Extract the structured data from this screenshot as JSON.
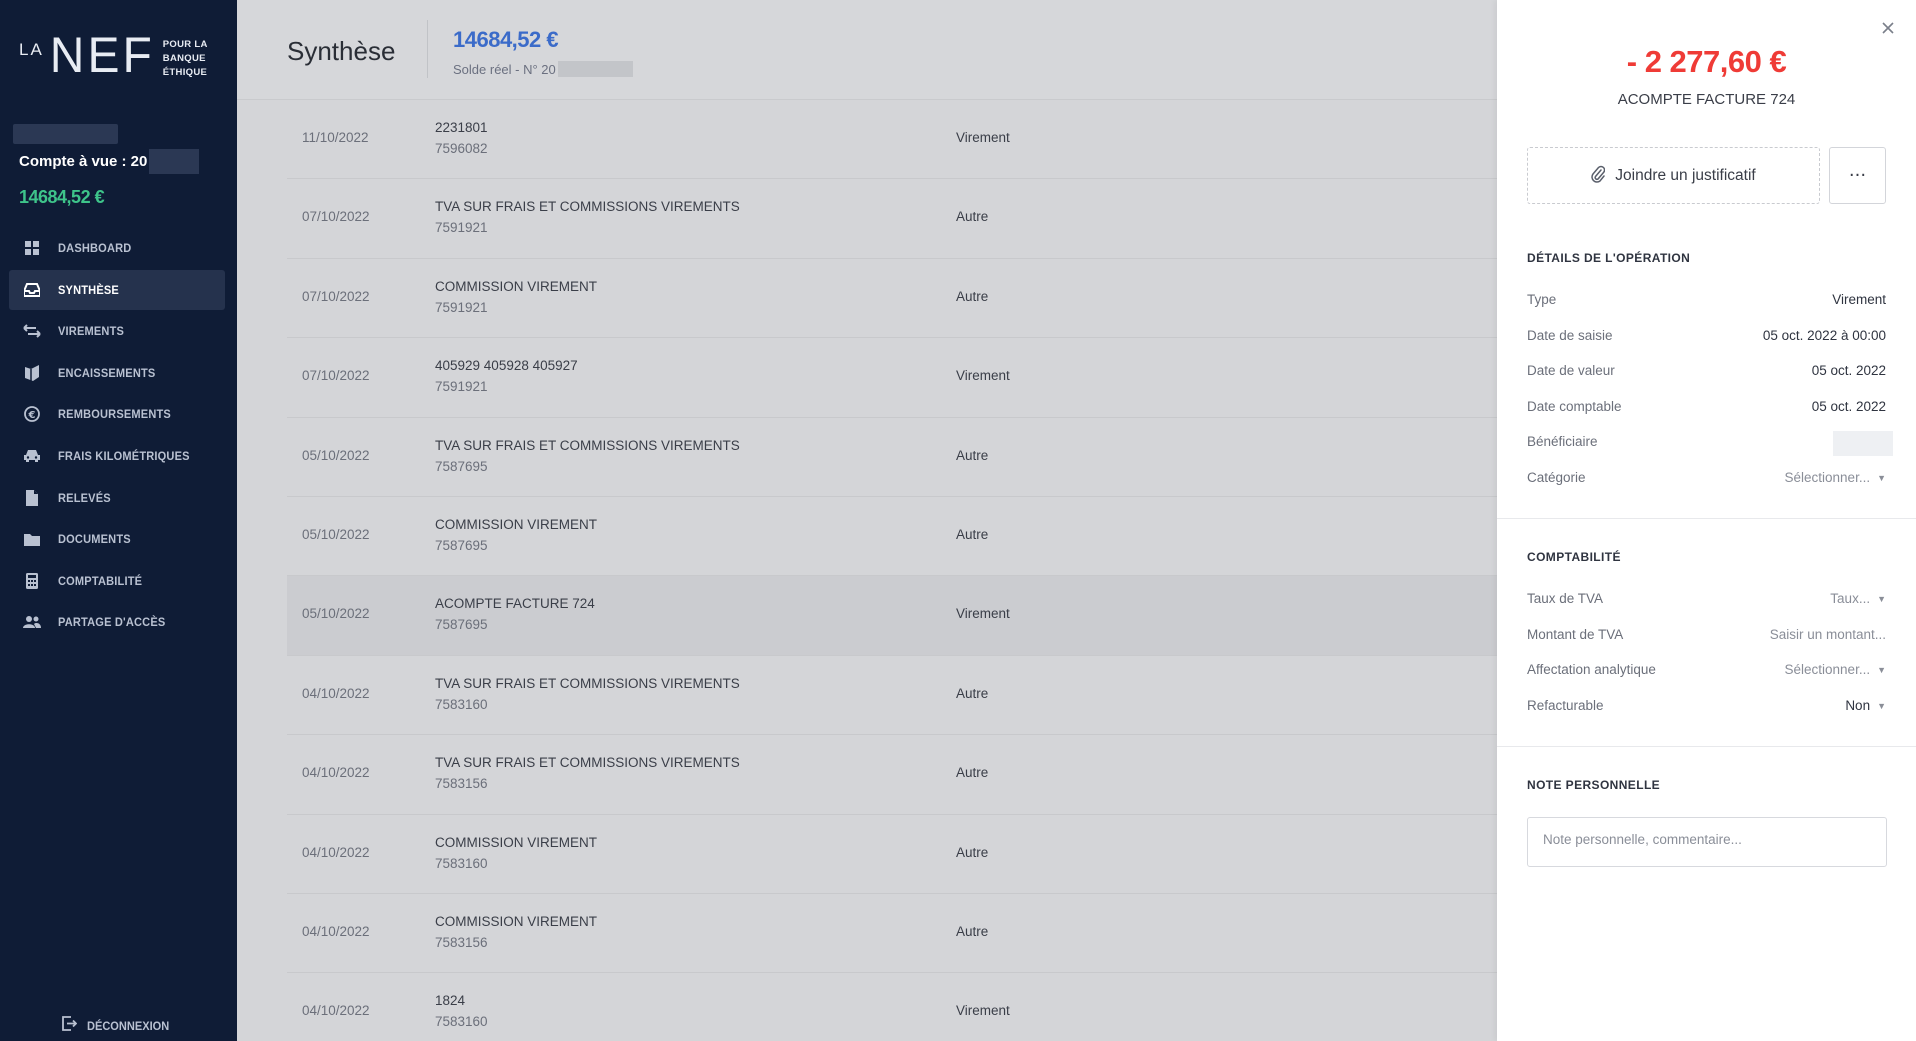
{
  "sidebar": {
    "logo": {
      "la": "LA",
      "nef": "NEF",
      "tagline": [
        "POUR LA",
        "BANQUE",
        "ÉTHIQUE"
      ]
    },
    "account_label": "Compte à vue : 20",
    "account_balance": "14684,52 €",
    "nav": [
      {
        "label": "DASHBOARD",
        "icon": "grid-icon",
        "active": false
      },
      {
        "label": "SYNTHÈSE",
        "icon": "inbox-icon",
        "active": true
      },
      {
        "label": "VIREMENTS",
        "icon": "arrows-exchange-icon",
        "active": false
      },
      {
        "label": "ENCAISSEMENTS",
        "icon": "receipt-icon",
        "active": false
      },
      {
        "label": "REMBOURSEMENTS",
        "icon": "euro-refund-icon",
        "active": false
      },
      {
        "label": "FRAIS KILOMÉTRIQUES",
        "icon": "car-icon",
        "active": false
      },
      {
        "label": "RELEVÉS",
        "icon": "file-icon",
        "active": false
      },
      {
        "label": "DOCUMENTS",
        "icon": "folder-icon",
        "active": false
      },
      {
        "label": "COMPTABILITÉ",
        "icon": "calculator-icon",
        "active": false
      },
      {
        "label": "PARTAGE D'ACCÈS",
        "icon": "users-icon",
        "active": false
      }
    ],
    "logout_label": "DÉCONNEXION"
  },
  "header": {
    "title": "Synthèse",
    "balance": "14684,52 €",
    "balance_sub": "Solde réel - N° 20"
  },
  "operations": [
    {
      "date": "11/10/2022",
      "label": "2231801",
      "ref": "7596082",
      "type": "Virement"
    },
    {
      "date": "07/10/2022",
      "label": "TVA SUR FRAIS ET COMMISSIONS VIREMENTS",
      "ref": "7591921",
      "type": "Autre"
    },
    {
      "date": "07/10/2022",
      "label": "COMMISSION VIREMENT",
      "ref": "7591921",
      "type": "Autre"
    },
    {
      "date": "07/10/2022",
      "label": "405929 405928 405927",
      "ref": "7591921",
      "type": "Virement"
    },
    {
      "date": "05/10/2022",
      "label": "TVA SUR FRAIS ET COMMISSIONS VIREMENTS",
      "ref": "7587695",
      "type": "Autre"
    },
    {
      "date": "05/10/2022",
      "label": "COMMISSION VIREMENT",
      "ref": "7587695",
      "type": "Autre"
    },
    {
      "date": "05/10/2022",
      "label": "ACOMPTE FACTURE 724",
      "ref": "7587695",
      "type": "Virement",
      "selected": true
    },
    {
      "date": "04/10/2022",
      "label": "TVA SUR FRAIS ET COMMISSIONS VIREMENTS",
      "ref": "7583160",
      "type": "Autre"
    },
    {
      "date": "04/10/2022",
      "label": "TVA SUR FRAIS ET COMMISSIONS VIREMENTS",
      "ref": "7583156",
      "type": "Autre"
    },
    {
      "date": "04/10/2022",
      "label": "COMMISSION VIREMENT",
      "ref": "7583160",
      "type": "Autre"
    },
    {
      "date": "04/10/2022",
      "label": "COMMISSION VIREMENT",
      "ref": "7583156",
      "type": "Autre"
    },
    {
      "date": "04/10/2022",
      "label": "1824",
      "ref": "7583160",
      "type": "Virement"
    }
  ],
  "detail": {
    "amount": "- 2 277,60 €",
    "label": "ACOMPTE FACTURE 724",
    "attach_label": "Joindre un justificatif",
    "more_label": "···",
    "section_details": "DÉTAILS DE L'OPÉRATION",
    "fields": [
      {
        "key": "Type",
        "value": "Virement"
      },
      {
        "key": "Date de saisie",
        "value": "05 oct. 2022 à 00:00"
      },
      {
        "key": "Date de valeur",
        "value": "05 oct. 2022"
      },
      {
        "key": "Date comptable",
        "value": "05 oct. 2022"
      },
      {
        "key": "Bénéficiaire",
        "value": ""
      },
      {
        "key": "Catégorie",
        "value": "Sélectionner..."
      }
    ],
    "section_compta": "COMPTABILITÉ",
    "compta_fields": [
      {
        "key": "Taux de TVA",
        "value": "Taux..."
      },
      {
        "key": "Montant de TVA",
        "value": "Saisir un montant..."
      },
      {
        "key": "Affectation analytique",
        "value": "Sélectionner..."
      },
      {
        "key": "Refacturable",
        "value": "Non"
      }
    ],
    "section_note": "NOTE PERSONNELLE",
    "note_placeholder": "Note personnelle, commentaire..."
  },
  "colors": {
    "sidebar_bg": "#0f1c36",
    "balance_green": "#3ec48a",
    "balance_blue": "#3b6bc9",
    "amount_red": "#ef3b36"
  }
}
